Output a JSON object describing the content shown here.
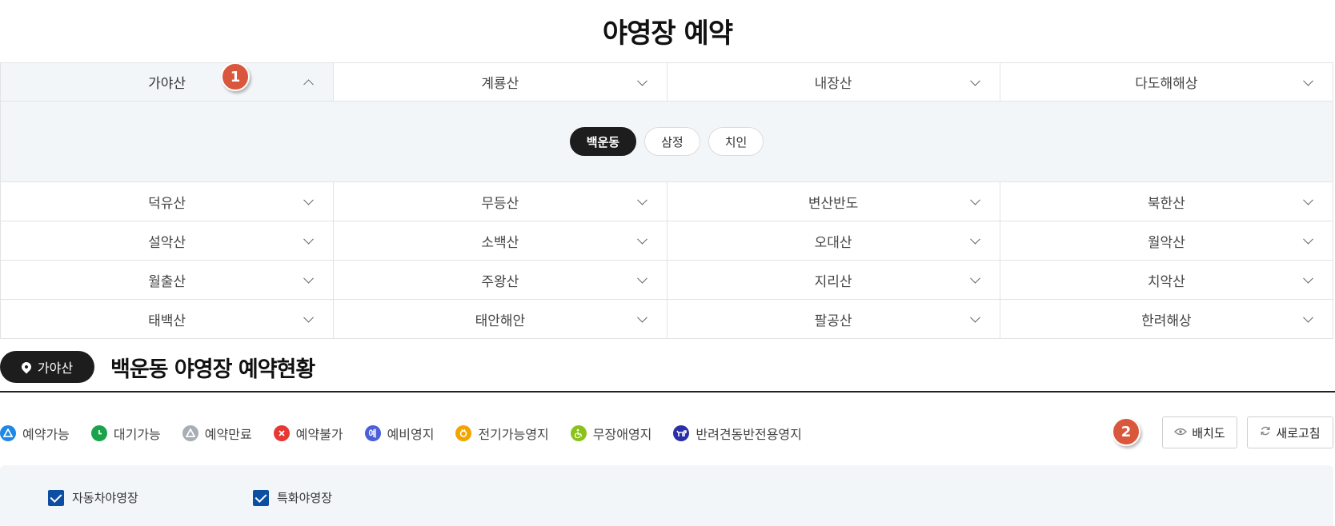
{
  "page": {
    "title": "야영장 예약"
  },
  "parks": {
    "row1": [
      {
        "label": "가야산",
        "expanded": true
      },
      {
        "label": "계룡산"
      },
      {
        "label": "내장산"
      },
      {
        "label": "다도해해상"
      }
    ],
    "sub_areas": [
      "백운동",
      "삼정",
      "치인"
    ],
    "sub_selected": "백운동",
    "row2": [
      "덕유산",
      "무등산",
      "변산반도",
      "북한산"
    ],
    "row3": [
      "설악산",
      "소백산",
      "오대산",
      "월악산"
    ],
    "row4": [
      "월출산",
      "주왕산",
      "지리산",
      "치악산"
    ],
    "row5": [
      "태백산",
      "태안해안",
      "팔공산",
      "한려해상"
    ]
  },
  "markers": {
    "m1": "1",
    "m2": "2"
  },
  "section": {
    "location": "가야산",
    "title": "백운동 야영장 예약현황"
  },
  "legend": [
    {
      "label": "예약가능",
      "color": "#1e88e5",
      "icon": "triangle-icon"
    },
    {
      "label": "대기가능",
      "color": "#1aa34a",
      "icon": "clock-icon"
    },
    {
      "label": "예약만료",
      "color": "#a9adb5",
      "icon": "triangle-icon"
    },
    {
      "label": "예약불가",
      "color": "#e53935",
      "icon": "x-icon"
    },
    {
      "label": "예비영지",
      "color": "#4a5fd8",
      "icon": "reserve-icon",
      "glyph": "예"
    },
    {
      "label": "전기가능영지",
      "color": "#f0a500",
      "icon": "plug-icon"
    },
    {
      "label": "무장애영지",
      "color": "#8bc21a",
      "icon": "wheelchair-icon"
    },
    {
      "label": "반려견동반전용영지",
      "color": "#2b2fa8",
      "icon": "dog-icon"
    }
  ],
  "buttons": {
    "layout": "배치도",
    "refresh": "새로고침"
  },
  "filters": [
    "자동차야영장",
    "특화야영장"
  ]
}
